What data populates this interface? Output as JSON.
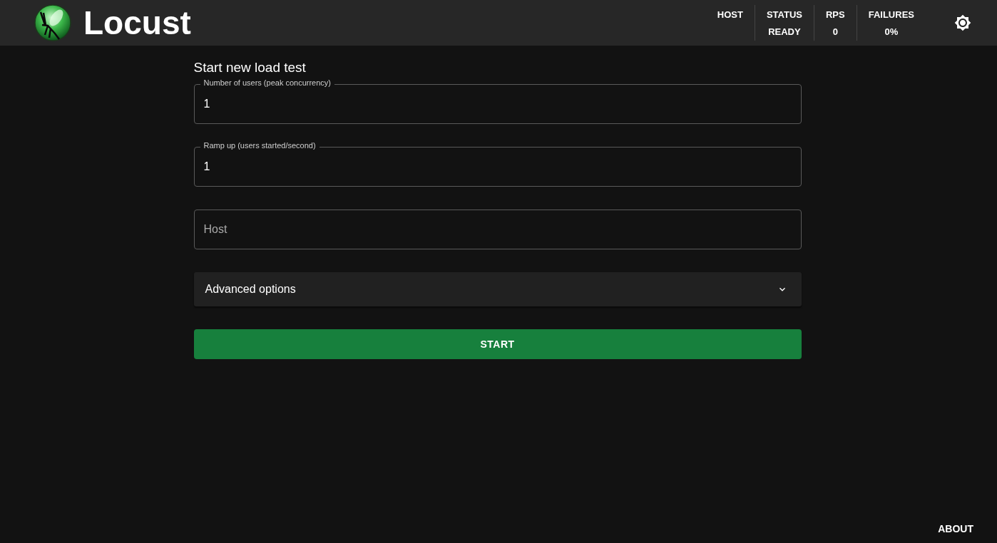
{
  "header": {
    "title": "Locust",
    "stats": [
      {
        "label": "HOST"
      },
      {
        "label": "STATUS",
        "value": "READY"
      },
      {
        "label": "RPS",
        "value": "0"
      },
      {
        "label": "FAILURES",
        "value": "0%"
      }
    ]
  },
  "form": {
    "title": "Start new load test",
    "fields": [
      {
        "label": "Number of users (peak concurrency)",
        "value": "1"
      },
      {
        "label": "Ramp up (users started/second)",
        "value": "1"
      },
      {
        "placeholder": "Host"
      }
    ],
    "advanced": {
      "label": "Advanced options",
      "expanded": false
    },
    "submit": "START"
  },
  "footer": {
    "link": "ABOUT"
  }
}
